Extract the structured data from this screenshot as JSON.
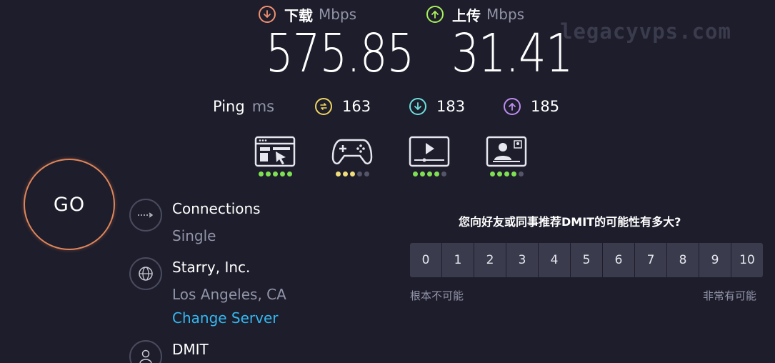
{
  "download": {
    "label": "下载",
    "unit": "Mbps",
    "value": "575.85",
    "color": "#f08f70"
  },
  "upload": {
    "label": "上传",
    "unit": "Mbps",
    "value": "31.41",
    "color": "#a6f05a"
  },
  "watermark": "legacyvps.com",
  "ping": {
    "label": "Ping",
    "unit": "ms",
    "idle": {
      "value": "163",
      "color": "#f0d561",
      "icon": "idle-latency-icon"
    },
    "download": {
      "value": "183",
      "color": "#6de0de",
      "icon": "download-latency-icon"
    },
    "upload": {
      "value": "185",
      "color": "#c08cf3",
      "icon": "upload-latency-icon"
    }
  },
  "experience": [
    {
      "icon": "browsing-icon",
      "rating": 5,
      "color": "#7ee053"
    },
    {
      "icon": "gaming-icon",
      "rating": 3,
      "color": "#f0dd7b"
    },
    {
      "icon": "streaming-icon",
      "rating": 4,
      "color": "#7ee053"
    },
    {
      "icon": "video-call-icon",
      "rating": 4,
      "color": "#7ee053"
    }
  ],
  "go_button": {
    "label": "GO",
    "color": "#e0865a"
  },
  "connections": {
    "title": "Connections",
    "value": "Single"
  },
  "isp": {
    "title": "Starry, Inc.",
    "location": "Los Angeles, CA",
    "change_server": "Change Server"
  },
  "host": {
    "title": "DMIT"
  },
  "survey": {
    "question": "您向好友或同事推荐DMIT的可能性有多大?",
    "options": [
      "0",
      "1",
      "2",
      "3",
      "4",
      "5",
      "6",
      "7",
      "8",
      "9",
      "10"
    ],
    "low_label": "根本不可能",
    "high_label": "非常有可能"
  }
}
